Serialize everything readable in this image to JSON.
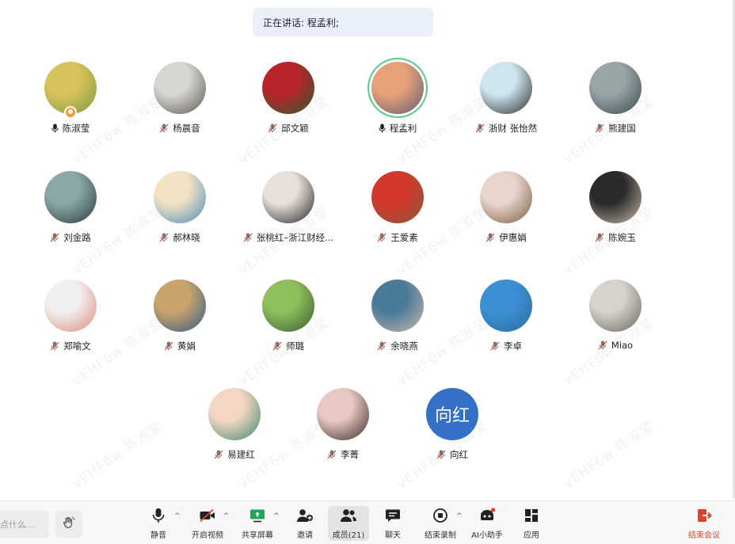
{
  "speaker_banner": "正在讲话: 程孟利;",
  "watermark_text": "vEHF6w 陈淑莹",
  "participants": [
    {
      "name": "陈淑莹",
      "mic": "on",
      "host": true,
      "avatar": "photo-tree",
      "colors": [
        "#d9c25b",
        "#7c9a45"
      ]
    },
    {
      "name": "杨晨音",
      "mic": "off",
      "avatar": "photo-sketch-portrait",
      "colors": [
        "#d8d6d2",
        "#5a5752"
      ]
    },
    {
      "name": "邱文颖",
      "mic": "off",
      "avatar": "photo-red-flowers",
      "colors": [
        "#b8242a",
        "#2f5c2a"
      ]
    },
    {
      "name": "程孟利",
      "mic": "on",
      "active": true,
      "avatar": "photo-sunset",
      "colors": [
        "#e8a07a",
        "#5b6070"
      ]
    },
    {
      "name": "浙财 张怡然",
      "mic": "off",
      "avatar": "photo-woman",
      "colors": [
        "#cfe6f0",
        "#2a2a2a"
      ]
    },
    {
      "name": "熊建国",
      "mic": "off",
      "avatar": "photo-mountains",
      "colors": [
        "#9aa5a8",
        "#3b4a4b"
      ]
    },
    {
      "name": "刘金路",
      "mic": "off",
      "avatar": "photo-presenter",
      "colors": [
        "#8aa8a8",
        "#2b3b3a"
      ]
    },
    {
      "name": "郝林晓",
      "mic": "off",
      "avatar": "illustration-lake",
      "colors": [
        "#f3e3c4",
        "#4a8bb8"
      ]
    },
    {
      "name": "张桃红–浙江财经...",
      "mic": "off",
      "avatar": "photo-smiling-girl",
      "colors": [
        "#e8e0d8",
        "#222222"
      ]
    },
    {
      "name": "王爱素",
      "mic": "off",
      "avatar": "photo-tulips",
      "colors": [
        "#d2382c",
        "#8a5a3c"
      ]
    },
    {
      "name": "伊惠娟",
      "mic": "off",
      "avatar": "photo-girl-flowers",
      "colors": [
        "#e8d6cc",
        "#7a5a44"
      ]
    },
    {
      "name": "陈婉玉",
      "mic": "off",
      "avatar": "photo-dark-portrait",
      "colors": [
        "#2a2a2a",
        "#c9b9a8"
      ]
    },
    {
      "name": "郑喻文",
      "mic": "off",
      "avatar": "photo-cat",
      "colors": [
        "#f2f0ee",
        "#d98a7a"
      ]
    },
    {
      "name": "黄娟",
      "mic": "off",
      "avatar": "photo-boats",
      "colors": [
        "#c9a36b",
        "#2f5a8a"
      ]
    },
    {
      "name": "师璐",
      "mic": "off",
      "avatar": "photo-river-trees",
      "colors": [
        "#8fbf5a",
        "#3b5a3a"
      ]
    },
    {
      "name": "余晓燕",
      "mic": "off",
      "avatar": "photo-family-sea",
      "colors": [
        "#4a7a9a",
        "#c8b8a8"
      ]
    },
    {
      "name": "李卓",
      "mic": "off",
      "avatar": "photo-sea-sky",
      "colors": [
        "#3d8fd4",
        "#2a6e9e"
      ]
    },
    {
      "name": "Miao",
      "mic": "off",
      "avatar": "drawing-tiger",
      "colors": [
        "#d6d2cc",
        "#6a665f"
      ]
    },
    {
      "name": "易建红",
      "mic": "off",
      "avatar": "illustration-girl",
      "colors": [
        "#f4d6c4",
        "#3a8a6a"
      ]
    },
    {
      "name": "李菁",
      "mic": "off",
      "avatar": "photo-young-woman",
      "colors": [
        "#e8c8c0",
        "#3a2a28"
      ]
    },
    {
      "name": "向红",
      "mic": "off",
      "avatar": "text-avatar",
      "avatar_text": "向红",
      "colors": [
        "#3570c7",
        "#3570c7"
      ]
    }
  ],
  "toolbar": {
    "comment_placeholder": "点什么...",
    "items": [
      {
        "label": "静音",
        "icon": "microphone-icon",
        "caret": true
      },
      {
        "label": "开启视频",
        "icon": "video-off-icon",
        "caret": true
      },
      {
        "label": "共享屏幕",
        "icon": "share-screen-icon",
        "caret": true,
        "accent": "#22a55a"
      },
      {
        "label": "邀请",
        "icon": "invite-user-icon"
      },
      {
        "label": "成员(21)",
        "icon": "members-icon",
        "selected": true
      },
      {
        "label": "聊天",
        "icon": "chat-icon"
      },
      {
        "label": "结束录制",
        "icon": "record-stop-icon",
        "caret": true
      },
      {
        "label": "AI小助手",
        "icon": "ai-assistant-icon",
        "badge_color": "#e0432b"
      },
      {
        "label": "应用",
        "icon": "apps-icon"
      },
      {
        "label": "结束会议",
        "icon": "leave-meeting-icon",
        "danger": true
      }
    ]
  },
  "colors": {
    "accent_green": "#5cc98a",
    "banner_bg": "#eaf0fb",
    "mute_red": "#e0432b"
  }
}
